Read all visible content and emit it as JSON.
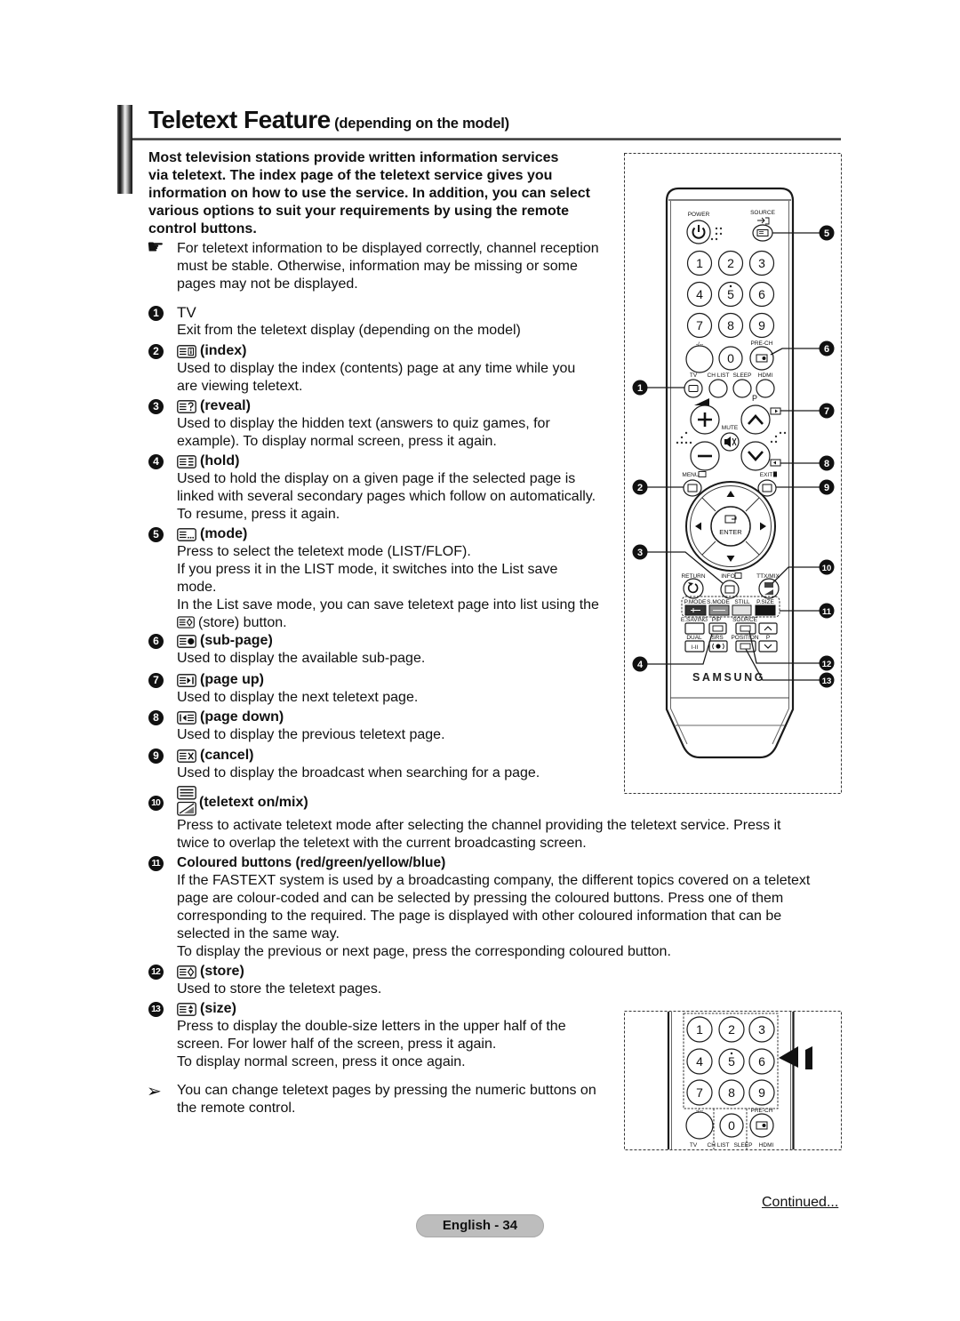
{
  "header": {
    "title": "Teletext Feature",
    "subtitle": "(depending on the model)"
  },
  "intro": {
    "lines": [
      "Most television stations provide written information services",
      "via teletext. The index page of the teletext service gives you",
      "information on how to use the service. In addition, you can select",
      "various options to suit your requirements by using the remote",
      "control buttons."
    ]
  },
  "note": {
    "icon": "pointing-hand-icon",
    "glyph": "☛",
    "lines": [
      "For teletext information to be displayed correctly, channel reception",
      "must be stable. Otherwise, information may be missing or some",
      "pages may not be displayed."
    ]
  },
  "items": [
    {
      "number": "1",
      "icon": "none",
      "title": "TV",
      "desc": [
        "Exit from the teletext display (depending on the model)"
      ]
    },
    {
      "number": "2",
      "icon": "teletext-index-icon",
      "title": "(index)",
      "desc": [
        "Used to display the index (contents) page at any time while you",
        "are viewing teletext."
      ]
    },
    {
      "number": "3",
      "icon": "teletext-reveal-icon",
      "title": "(reveal)",
      "desc": [
        "Used to display the hidden text (answers to quiz games, for",
        "example). To display normal screen, press it again."
      ]
    },
    {
      "number": "4",
      "icon": "teletext-hold-icon",
      "title": "(hold)",
      "desc": [
        "Used to hold the display on a given page if the selected page is",
        "linked with several secondary pages which follow on automatically.",
        "To resume, press it again."
      ]
    },
    {
      "number": "5",
      "icon": "teletext-mode-icon",
      "title": "(mode)",
      "desc": [
        "Press to select the teletext mode (LIST/FLOF).",
        "If you press it in the LIST mode, it switches into the List save",
        "mode.",
        "In the List save mode, you can save teletext page into list using the",
        "(store) button."
      ]
    },
    {
      "number": "6",
      "icon": "teletext-sub-page-icon",
      "title": "(sub-page)",
      "desc": [
        "Used to display the available sub-page."
      ]
    },
    {
      "number": "7",
      "icon": "teletext-page-up-icon",
      "title": "(page up)",
      "desc": [
        "Used to display the next teletext page."
      ]
    },
    {
      "number": "8",
      "icon": "teletext-page-down-icon",
      "title": "(page down)",
      "desc": [
        "Used to display the previous teletext page."
      ]
    },
    {
      "number": "9",
      "icon": "teletext-cancel-icon",
      "title": "(cancel)",
      "desc": [
        "Used to display the broadcast when searching for a page."
      ]
    },
    {
      "number": "10",
      "icon": "teletext-on-mix-icon",
      "title": "(teletext on/mix)",
      "desc": [
        "Press to activate teletext mode after selecting the channel providing the teletext service. Press it",
        "twice to overlap the teletext with the current broadcasting screen."
      ]
    },
    {
      "number": "11",
      "icon": "none",
      "title": "Coloured buttons (red/green/yellow/blue)",
      "desc": [
        "If the FASTEXT system is used by a broadcasting company, the different topics covered on a teletext",
        "page are colour-coded and can be selected by pressing the coloured buttons. Press one of them",
        "corresponding to the required. The page is displayed with other coloured information that can be",
        "selected in the same way.",
        "To display the previous or next page, press the corresponding coloured button."
      ]
    },
    {
      "number": "12",
      "icon": "teletext-store-icon",
      "title": "(store)",
      "desc": [
        "Used to store the teletext pages."
      ]
    },
    {
      "number": "13",
      "icon": "teletext-size-icon",
      "title": "(size)",
      "desc": [
        "Press to display the double-size letters in the upper half of the",
        "screen. For lower half of the screen, press it again.",
        "To display normal screen, press it once again."
      ]
    }
  ],
  "tip": {
    "icon": "arrow-right-icon",
    "glyph": "➢",
    "lines": [
      "You can change teletext pages by pressing the numeric buttons on",
      "the remote control."
    ]
  },
  "remote": {
    "power_label": "POWER",
    "source_label": "SOURCE",
    "numbers": [
      "1",
      "2",
      "3",
      "4",
      "5",
      "6",
      "7",
      "8",
      "9",
      "0"
    ],
    "dash_label": "-/--",
    "prech_label": "PRE-CH",
    "row_labels": [
      "TV",
      "CH LIST",
      "SLEEP",
      "HDMI"
    ],
    "p_label": "P",
    "mute_label": "MUTE",
    "menu_label": "MENU",
    "exit_label": "EXIT",
    "enter_label": "ENTER",
    "return_label": "RETURN",
    "info_label": "INFO",
    "ttx_label": "TTX/MIX",
    "color_labels": [
      "P.MODE",
      "S.MODE",
      "STILL",
      "P.SIZE"
    ],
    "color_button_fills": [
      "#333333",
      "#8c8c8c",
      "#e2e2e2",
      "#141414"
    ],
    "row3_labels": [
      "E.SAVING",
      "PIP",
      "SOURCE"
    ],
    "row4_labels": [
      "DUAL",
      "SRS",
      "POSITION",
      "P"
    ],
    "dual_button": "I-II",
    "brand": "SAMSUNG",
    "callouts": [
      "1",
      "2",
      "3",
      "4",
      "5",
      "6",
      "7",
      "8",
      "9",
      "10",
      "11",
      "12",
      "13"
    ]
  },
  "remote_detail": {
    "numbers": [
      "1",
      "2",
      "3",
      "4",
      "5",
      "6",
      "7",
      "8",
      "9",
      "0"
    ],
    "dash_label": "-/--",
    "prech_label": "PRE-CH",
    "row_labels": [
      "TV",
      "CH LIST",
      "SLEEP",
      "HDMI"
    ]
  },
  "footer": {
    "continued": "Continued...",
    "page_label": "English - 34"
  },
  "colors": {
    "badge": "#111111",
    "page_pill": "#bdbdbd",
    "text": "#111111"
  }
}
